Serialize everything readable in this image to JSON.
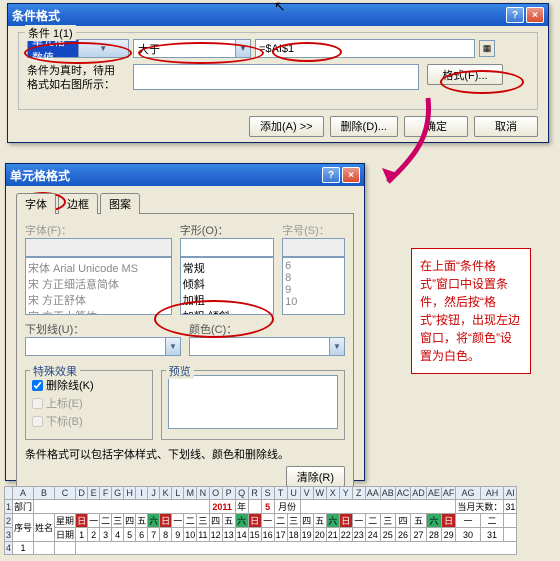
{
  "cursor": "↖",
  "cf": {
    "title": "条件格式",
    "help": "?",
    "close": "×",
    "cond_legend": "条件 1(1)",
    "field1": "单元格数值",
    "op": "大于",
    "val": "=$AI$1",
    "previewlbl": "条件为真时，待用\n格式如右图所示：",
    "format_btn": "格式(F)...",
    "add_btn": "添加(A) >>",
    "del_btn": "删除(D)...",
    "ok": "确定",
    "cancel": "取消"
  },
  "fmt": {
    "title": "单元格格式",
    "help": "?",
    "close": "×",
    "tabs": [
      "字体",
      "边框",
      "图案"
    ],
    "font_lbl": "字体(F)：",
    "style_lbl": "字形(O)：",
    "size_lbl": "字号(S)：",
    "fonts": [
      "宋体 Arial Unicode MS",
      "宋 方正细活意简体",
      "宋 方正舒体",
      "宋 方正小篆体"
    ],
    "styles": [
      "常规",
      "倾斜",
      "加粗",
      "加粗 倾斜"
    ],
    "sizes": [
      "6",
      "8",
      "9",
      "10"
    ],
    "underline_lbl": "下划线(U)：",
    "color_lbl": "颜色(C)：",
    "fx_legend": "特殊效果",
    "strike": "删除线(K)",
    "sup": "上标(E)",
    "sub": "下标(B)",
    "prev_legend": "预览",
    "note": "条件格式可以包括字体样式、下划线、颜色和删除线。",
    "clear": "清除(R)",
    "ok": "确定",
    "cancel": "取消"
  },
  "annot": {
    "text": "在上面“条件格式”窗口中设置条件，然后按“格式”按钮，出现左边窗口，将“颜色”设置为白色。"
  },
  "sheet": {
    "cols": [
      "A",
      "B",
      "C",
      "D",
      "E",
      "F",
      "G",
      "H",
      "I",
      "J",
      "K",
      "L",
      "M",
      "N",
      "O",
      "P",
      "Q",
      "R",
      "S",
      "T",
      "U",
      "V",
      "W",
      "X",
      "Y",
      "Z",
      "AA",
      "AB",
      "AC",
      "AD",
      "AE",
      "AF",
      "AG",
      "AH",
      "AI"
    ],
    "title_year": "2011",
    "title_y": "年",
    "title_month": "5",
    "title_m": "月份",
    "curday": "当月天数：",
    "curdayval": "31",
    "dept": "部门",
    "xm": "姓名",
    "xh": "序号",
    "wk": "星期",
    "dt": "日期",
    "wkdays": [
      "日",
      "一",
      "二",
      "三",
      "四",
      "五",
      "六",
      "日",
      "一",
      "二",
      "三",
      "四",
      "五",
      "六",
      "日",
      "一",
      "二",
      "三",
      "四",
      "五",
      "六",
      "日",
      "一",
      "二",
      "三",
      "四",
      "五",
      "六",
      "日",
      "一",
      "二"
    ],
    "days": [
      "1",
      "2",
      "3",
      "4",
      "5",
      "6",
      "7",
      "8",
      "9",
      "10",
      "11",
      "12",
      "13",
      "14",
      "15",
      "16",
      "17",
      "18",
      "19",
      "20",
      "21",
      "22",
      "23",
      "24",
      "25",
      "26",
      "27",
      "28",
      "29",
      "30",
      "31"
    ]
  }
}
